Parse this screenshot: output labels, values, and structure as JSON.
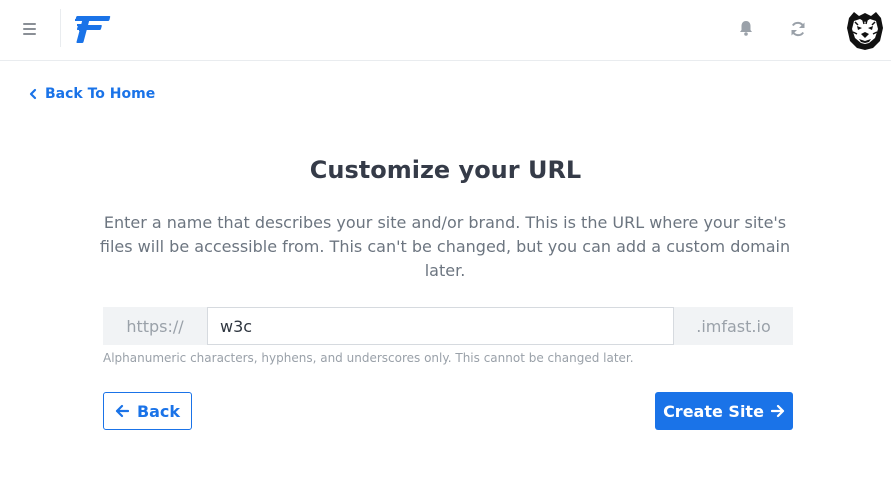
{
  "nav": {
    "menu_icon": "hamburger-icon",
    "logo_icon": "imfast-logo",
    "notification_icon": "bell-icon",
    "refresh_icon": "refresh-icon",
    "avatar_icon": "tiger-avatar"
  },
  "back_link": {
    "label": "Back To Home"
  },
  "page": {
    "title": "Customize your URL",
    "description": "Enter a name that describes your site and/or brand. This is the URL where your site's files will be accessible from. This can't be changed, but you can add a custom domain later."
  },
  "url_field": {
    "prefix": "https://",
    "value": "w3c",
    "suffix": ".imfast.io",
    "hint": "Alphanumeric characters, hyphens, and underscores only. This cannot be changed later."
  },
  "actions": {
    "back_label": "Back",
    "create_label": "Create Site"
  },
  "colors": {
    "accent": "#1a73e8",
    "title": "#353b48",
    "muted": "#6c7580"
  }
}
